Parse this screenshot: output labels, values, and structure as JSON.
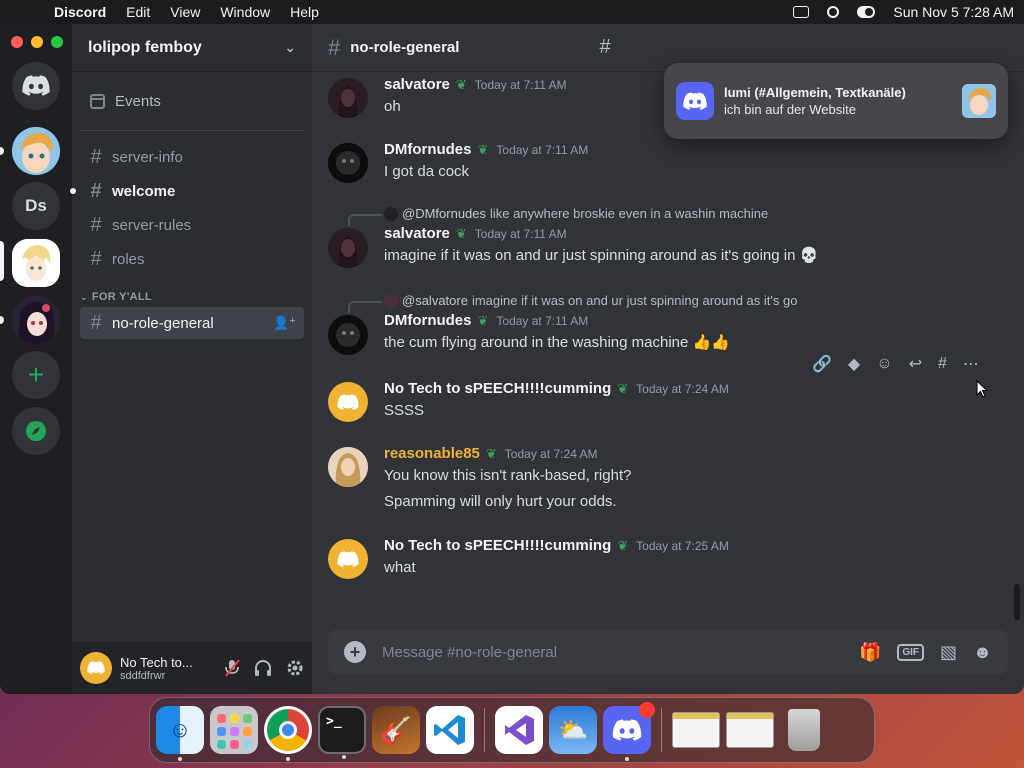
{
  "menubar": {
    "app": "Discord",
    "items": [
      "Edit",
      "View",
      "Window",
      "Help"
    ],
    "datetime": "Sun Nov 5  7:28 AM"
  },
  "servers": {
    "ds_label": "Ds"
  },
  "sidebar": {
    "server_name": "lolipop femboy",
    "events": "Events",
    "channels": [
      {
        "name": "server-info"
      },
      {
        "name": "welcome"
      },
      {
        "name": "server-rules"
      },
      {
        "name": "roles"
      }
    ],
    "category": "FOR Y'ALL",
    "active_channel": "no-role-general"
  },
  "user": {
    "name": "No Tech to...",
    "tag": "sddfdfrwr"
  },
  "channel": {
    "name": "no-role-general"
  },
  "messages": [
    {
      "author": "salvatore",
      "time": "Today at 7:11 AM",
      "text": "oh"
    },
    {
      "author": "DMfornudes",
      "time": "Today at 7:11 AM",
      "text": "I got da cock"
    },
    {
      "reply_to": "@DMfornudes",
      "reply_text": "like anywhere broskie even in a washin machine",
      "author": "salvatore",
      "time": "Today at 7:11 AM",
      "text": "imagine if it was on and ur just spinning around as it's going in 💀"
    },
    {
      "reply_to": "@salvatore",
      "reply_text": "imagine if it was on and ur just spinning around as it's go",
      "author": "DMfornudes",
      "time": "Today at 7:11 AM",
      "text": "the cum flying around in the washing machine 👍👍"
    },
    {
      "author": "No Tech to sPEECH!!!!cumming",
      "time": "Today at 7:24 AM",
      "text": "SSSS"
    },
    {
      "author": "reasonable85",
      "time": "Today at 7:24 AM",
      "text": "You know this isn't rank-based, right?",
      "text2": "Spamming will only hurt your odds."
    },
    {
      "author": "No Tech to sPEECH!!!!cumming",
      "time": "Today at 7:25 AM",
      "text": "what"
    }
  ],
  "composer": {
    "placeholder": "Message #no-role-general",
    "gif_label": "GIF"
  },
  "notification": {
    "title": "lumi (#Allgemein, Textkanäle)",
    "body": "ich bin auf der Website"
  },
  "colors": {
    "blurple": "#5865f2",
    "gold_name": "#f0b232",
    "sprout": "#3ba55c"
  }
}
